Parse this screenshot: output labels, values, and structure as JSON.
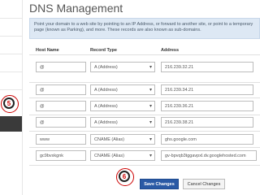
{
  "page": {
    "title": "DNS Management",
    "info_text": "Point your domain to a web site by pointing to an IP Address, or forward to another site, or point to a temporary page (known as Parking), and more. These records are also known as sub-domains."
  },
  "table": {
    "headers": {
      "host": "Host Name",
      "type": "Record Type",
      "address": "Address"
    },
    "rows": [
      {
        "host": "@",
        "type": "A (Address)",
        "address": "216.239.32.21"
      },
      {
        "host": "@",
        "type": "A (Address)",
        "address": "216.239.34.21"
      },
      {
        "host": "@",
        "type": "A (Address)",
        "address": "216.239.36.21"
      },
      {
        "host": "@",
        "type": "A (Address)",
        "address": "216.239.38.21"
      },
      {
        "host": "www",
        "type": "CNAME (Alias)",
        "address": "ghs.google.com"
      },
      {
        "host": "gc9bvxkgnk",
        "type": "CNAME (Alias)",
        "address": "gv-bpvqb3tggavpxl.dv.googlehosted.com"
      }
    ]
  },
  "buttons": {
    "save": "Save Changes",
    "cancel": "Cancel Changes"
  },
  "markers": {
    "sidebar_marker": "5",
    "save_marker": "6"
  }
}
